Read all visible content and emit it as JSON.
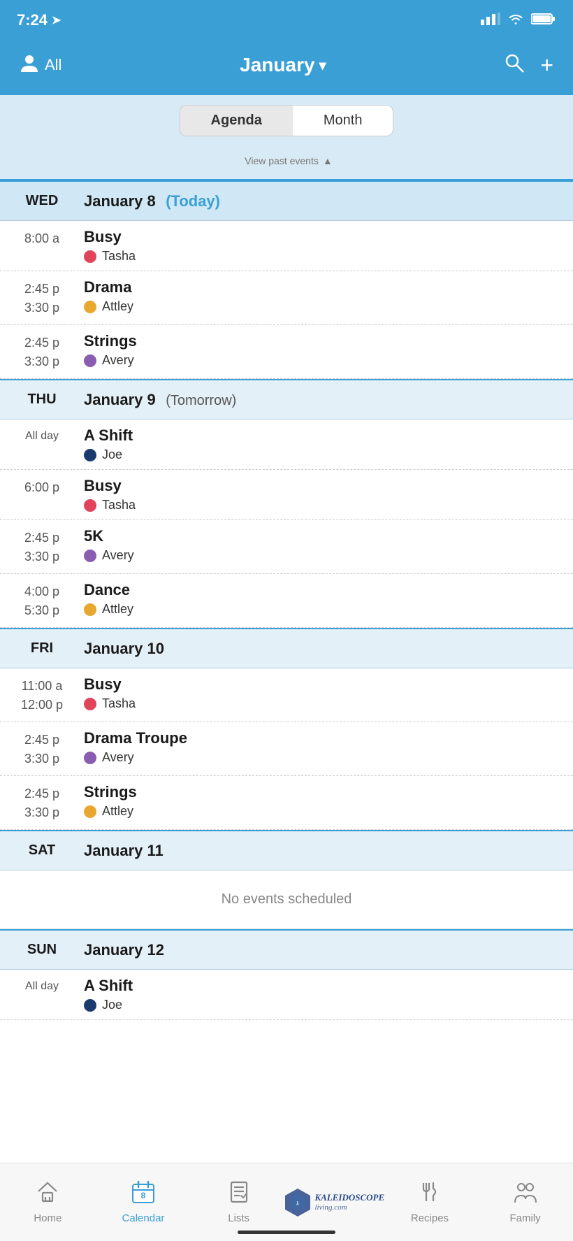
{
  "statusBar": {
    "time": "7:24",
    "locationIcon": "➤",
    "signalBars": "▂▄▆",
    "wifiIcon": "wifi",
    "batteryIcon": "battery"
  },
  "header": {
    "allLabel": "All",
    "monthTitle": "January",
    "monthArrow": "▾",
    "searchLabel": "search",
    "addLabel": "+"
  },
  "toggle": {
    "agendaLabel": "Agenda",
    "monthLabel": "Month",
    "activeTab": "Agenda"
  },
  "viewPast": {
    "label": "View past events",
    "arrow": "▲"
  },
  "days": [
    {
      "dow": "WED",
      "date": "January 8",
      "isToday": true,
      "todayLabel": "(Today)",
      "events": [
        {
          "timeStart": "8:00 a",
          "timeEnd": "",
          "title": "Busy",
          "person": "Tasha",
          "dotColor": "#e0445a",
          "allDay": false
        },
        {
          "timeStart": "2:45 p",
          "timeEnd": "3:30 p",
          "title": "Drama",
          "person": "Attley",
          "dotColor": "#e8a830",
          "allDay": false
        },
        {
          "timeStart": "2:45 p",
          "timeEnd": "3:30 p",
          "title": "Strings",
          "person": "Avery",
          "dotColor": "#8b5db0",
          "allDay": false
        }
      ]
    },
    {
      "dow": "THU",
      "date": "January 9",
      "isToday": false,
      "todayLabel": "(Tomorrow)",
      "events": [
        {
          "timeStart": "All day",
          "timeEnd": "",
          "title": "A Shift",
          "person": "Joe",
          "dotColor": "#1a3a6e",
          "allDay": true
        },
        {
          "timeStart": "6:00 p",
          "timeEnd": "",
          "title": "Busy",
          "person": "Tasha",
          "dotColor": "#e0445a",
          "allDay": false
        },
        {
          "timeStart": "2:45 p",
          "timeEnd": "3:30 p",
          "title": "5K",
          "person": "Avery",
          "dotColor": "#8b5db0",
          "allDay": false
        },
        {
          "timeStart": "4:00 p",
          "timeEnd": "5:30 p",
          "title": "Dance",
          "person": "Attley",
          "dotColor": "#e8a830",
          "allDay": false
        }
      ]
    },
    {
      "dow": "FRI",
      "date": "January 10",
      "isToday": false,
      "todayLabel": "",
      "events": [
        {
          "timeStart": "11:00 a",
          "timeEnd": "12:00 p",
          "title": "Busy",
          "person": "Tasha",
          "dotColor": "#e0445a",
          "allDay": false
        },
        {
          "timeStart": "2:45 p",
          "timeEnd": "3:30 p",
          "title": "Drama Troupe",
          "person": "Avery",
          "dotColor": "#8b5db0",
          "allDay": false
        },
        {
          "timeStart": "2:45 p",
          "timeEnd": "3:30 p",
          "title": "Strings",
          "person": "Attley",
          "dotColor": "#e8a830",
          "allDay": false
        }
      ]
    },
    {
      "dow": "SAT",
      "date": "January 11",
      "isToday": false,
      "todayLabel": "",
      "events": [],
      "noEvents": "No events scheduled"
    },
    {
      "dow": "SUN",
      "date": "January 12",
      "isToday": false,
      "todayLabel": "",
      "events": [
        {
          "timeStart": "All day",
          "timeEnd": "",
          "title": "A Shift",
          "person": "Joe",
          "dotColor": "#1a3a6e",
          "allDay": true
        }
      ]
    }
  ],
  "bottomNav": [
    {
      "icon": "⌂",
      "label": "Home",
      "active": false
    },
    {
      "icon": "📅",
      "label": "Calendar",
      "active": true
    },
    {
      "icon": "📋",
      "label": "Lists",
      "active": false
    },
    {
      "icon": "🍴",
      "label": "Recipes",
      "active": false
    },
    {
      "icon": "👥",
      "label": "Family",
      "active": false
    }
  ]
}
